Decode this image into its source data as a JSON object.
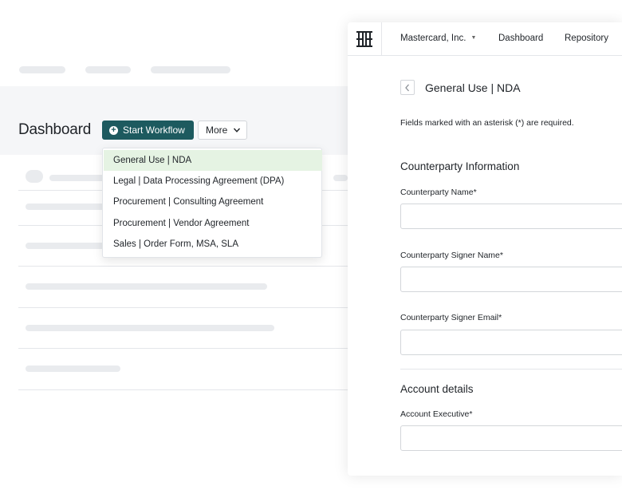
{
  "dashboard": {
    "title": "Dashboard",
    "start_workflow_label": "Start Workflow",
    "more_label": "More"
  },
  "workflow_menu": {
    "items": [
      {
        "label": "General Use | NDA",
        "selected": true
      },
      {
        "label": "Legal | Data Processing Agreement (DPA)"
      },
      {
        "label": "Procurement | Consulting Agreement"
      },
      {
        "label": "Procurement | Vendor Agreement"
      },
      {
        "label": "Sales | Order Form, MSA, SLA"
      }
    ]
  },
  "panel_nav": {
    "company": "Mastercard, Inc.",
    "dashboard": "Dashboard",
    "repository": "Repository"
  },
  "form": {
    "title": "General Use | NDA",
    "required_note": "Fields marked with an asterisk (*) are required.",
    "section_counterparty": "Counterparty Information",
    "counterparty_name_label": "Counterparty Name*",
    "counterparty_name_value": "",
    "signer_name_label": "Counterparty Signer Name*",
    "signer_name_value": "",
    "signer_email_label": "Counterparty Signer Email*",
    "signer_email_value": "",
    "section_account": "Account details",
    "account_exec_label": "Account Executive*",
    "account_exec_value": ""
  },
  "colors": {
    "primary_button": "#1d5a5f",
    "selected_item": "#e5f3e3",
    "skeleton": "#e9ebee"
  },
  "icons": {
    "logo": "brand-logo-icon",
    "start": "plus-circle-icon",
    "more": "chevron-down-icon",
    "company": "caret-down-icon",
    "back": "chevron-left-icon"
  }
}
